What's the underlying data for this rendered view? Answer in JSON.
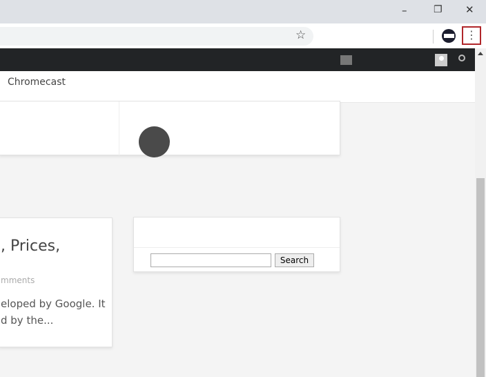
{
  "window": {
    "minimize": "–",
    "restore": "❐",
    "close": "✕"
  },
  "toolbar": {
    "bookmark_icon": "☆",
    "menu_icon": "⋮"
  },
  "site": {
    "menu_items": [
      "Chromecast"
    ]
  },
  "post": {
    "title": ", Prices,",
    "meta": "mments",
    "excerpt_line1": "eloped by Google. It",
    "excerpt_line2": "d by the..."
  },
  "search_widget": {
    "button_label": "Search",
    "input_value": ""
  }
}
